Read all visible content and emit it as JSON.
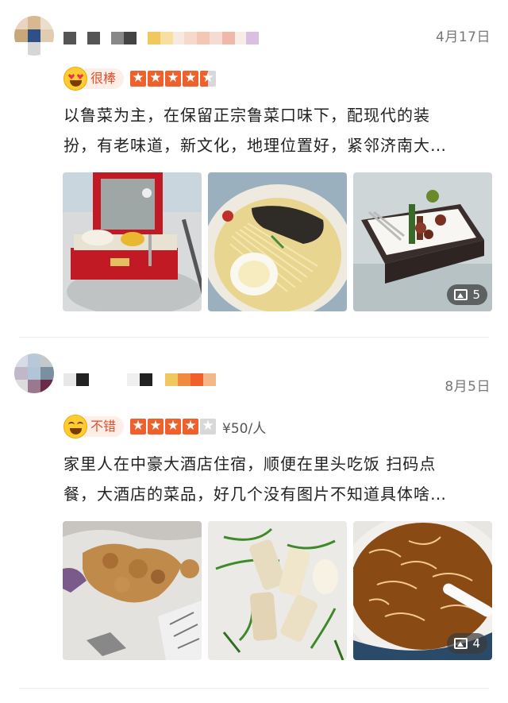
{
  "reviews": [
    {
      "date": "4月17日",
      "rating_label": "很棒",
      "stars": 4.5,
      "price": "",
      "text_line1": "以鲁菜为主，在保留正宗鲁菜口味下，配现代的装",
      "text_line2": "扮，有老味道，新文化，地理位置好，紧邻济南大…",
      "photo_count": "5",
      "emoji": "heart-eyes-emoji-icon"
    },
    {
      "date": "8月5日",
      "rating_label": "不错",
      "stars": 4,
      "price": "¥50/人",
      "text_line1": "家里人在中豪大酒店住宿，顺便在里头吃饭 扫码点",
      "text_line2": "餐，大酒店的菜品，好几个没有图片不知道具体啥…",
      "photo_count": "4",
      "emoji": "laughing-emoji-icon"
    }
  ],
  "colors": {
    "accent": "#f0602a",
    "label_bg": "#fdeee8",
    "label_text": "#e0502a"
  }
}
